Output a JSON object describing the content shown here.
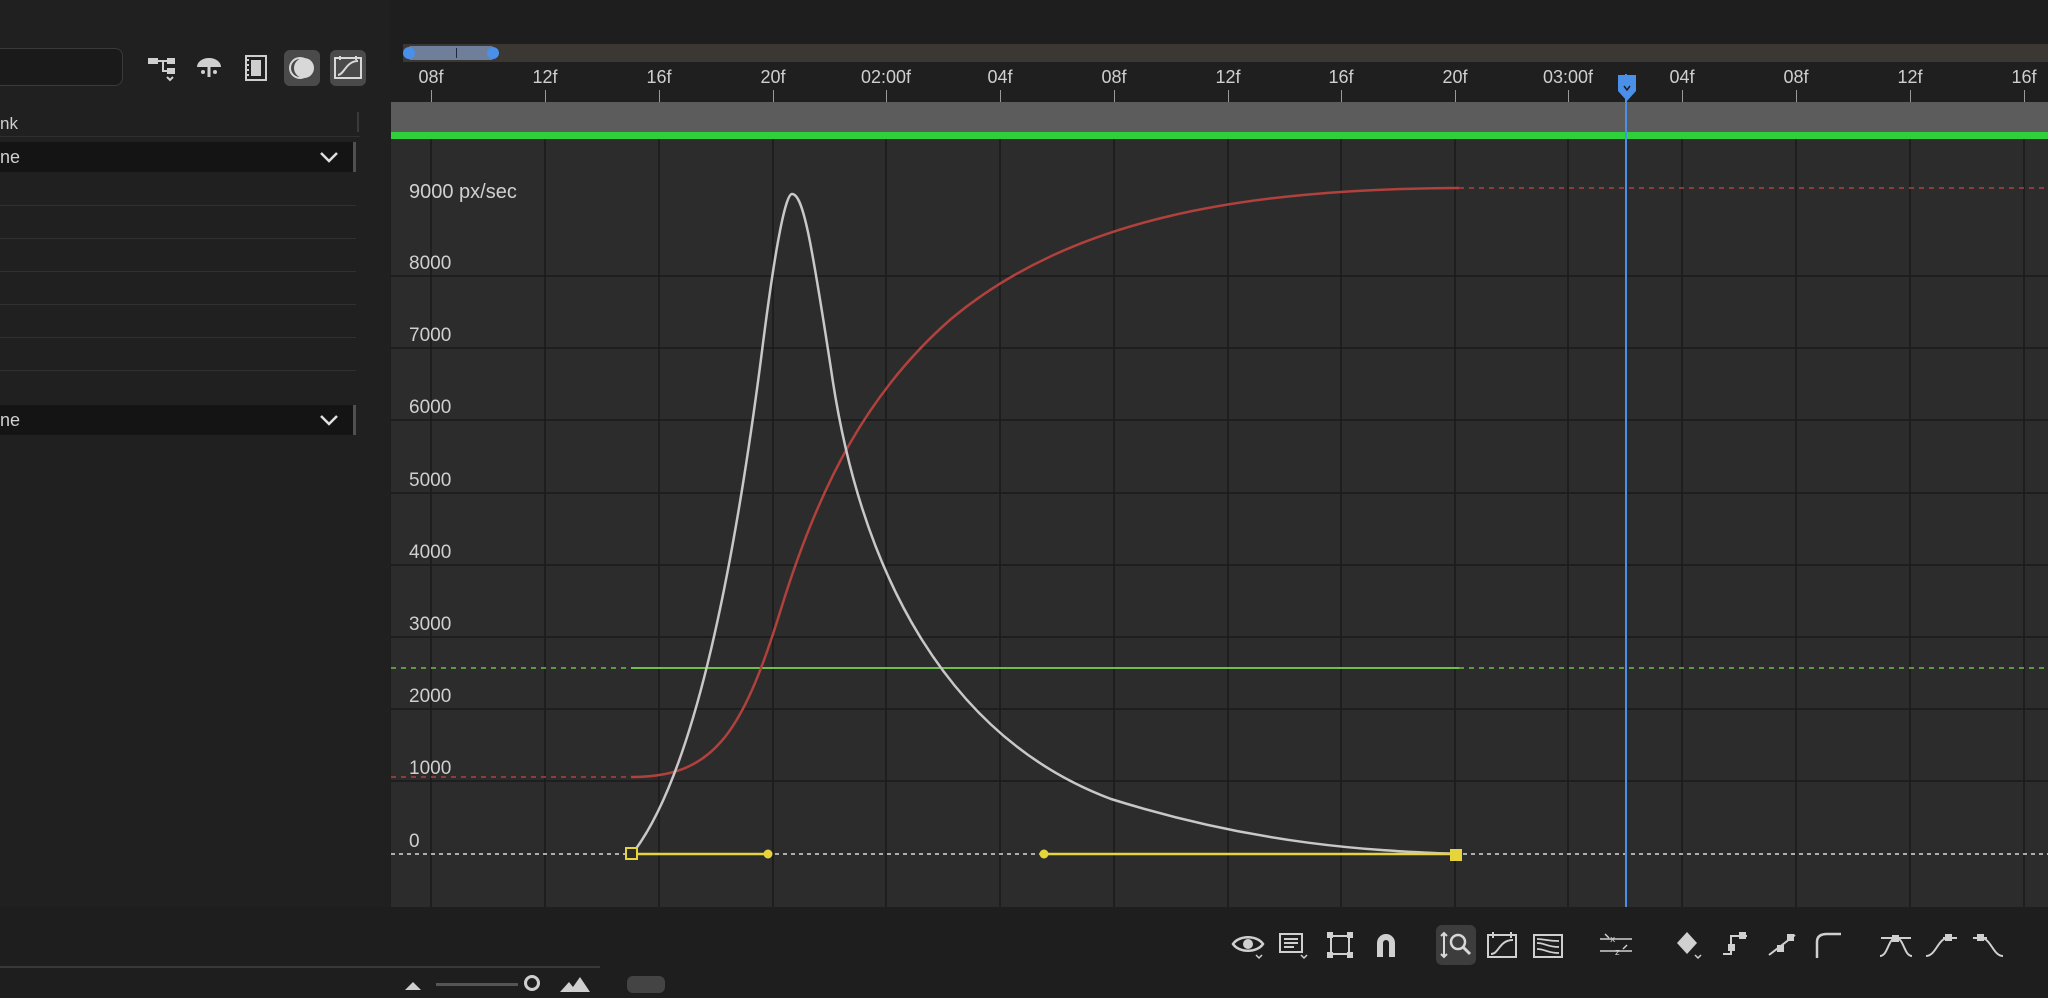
{
  "left_panel": {
    "column_header": "nk",
    "dropdown1_value": "ne",
    "dropdown2_value": "ne"
  },
  "toolbar_icons": [
    "flowchart-icon",
    "umbrella-icon",
    "filmstrip-icon",
    "motion-blur-icon",
    "graph-editor-icon"
  ],
  "ruler": {
    "labels": [
      "08f",
      "12f",
      "16f",
      "20f",
      "02:00f",
      "04f",
      "08f",
      "12f",
      "16f",
      "20f",
      "03:00f",
      "04f",
      "08f",
      "12f",
      "16f"
    ],
    "playhead_frame": "03:02f"
  },
  "graph": {
    "y_unit_label": "9000 px/sec",
    "y_labels": [
      "8000",
      "7000",
      "6000",
      "5000",
      "4000",
      "3000",
      "2000",
      "1000",
      "0"
    ]
  },
  "colors": {
    "speed_curve": "#c8c8c8",
    "value_curve": "#b0413c",
    "green_curve": "#6dbf4a",
    "keyframe": "#e6d43c",
    "playhead": "#4a8fe8",
    "green_bar": "#2ed13c"
  },
  "bottom_toolbar": {
    "icons": [
      "eye-icon",
      "graph-type-icon",
      "transform-box-icon",
      "snap-magnet-icon",
      "fit-height-icon",
      "fit-selection-icon",
      "fit-all-icon",
      "separate-dimensions-icon",
      "keyframe-diamond-icon",
      "hold-keyframe-icon",
      "linear-keyframe-icon",
      "auto-bezier-icon",
      "easy-ease-icon",
      "ease-in-icon",
      "ease-out-icon"
    ]
  }
}
